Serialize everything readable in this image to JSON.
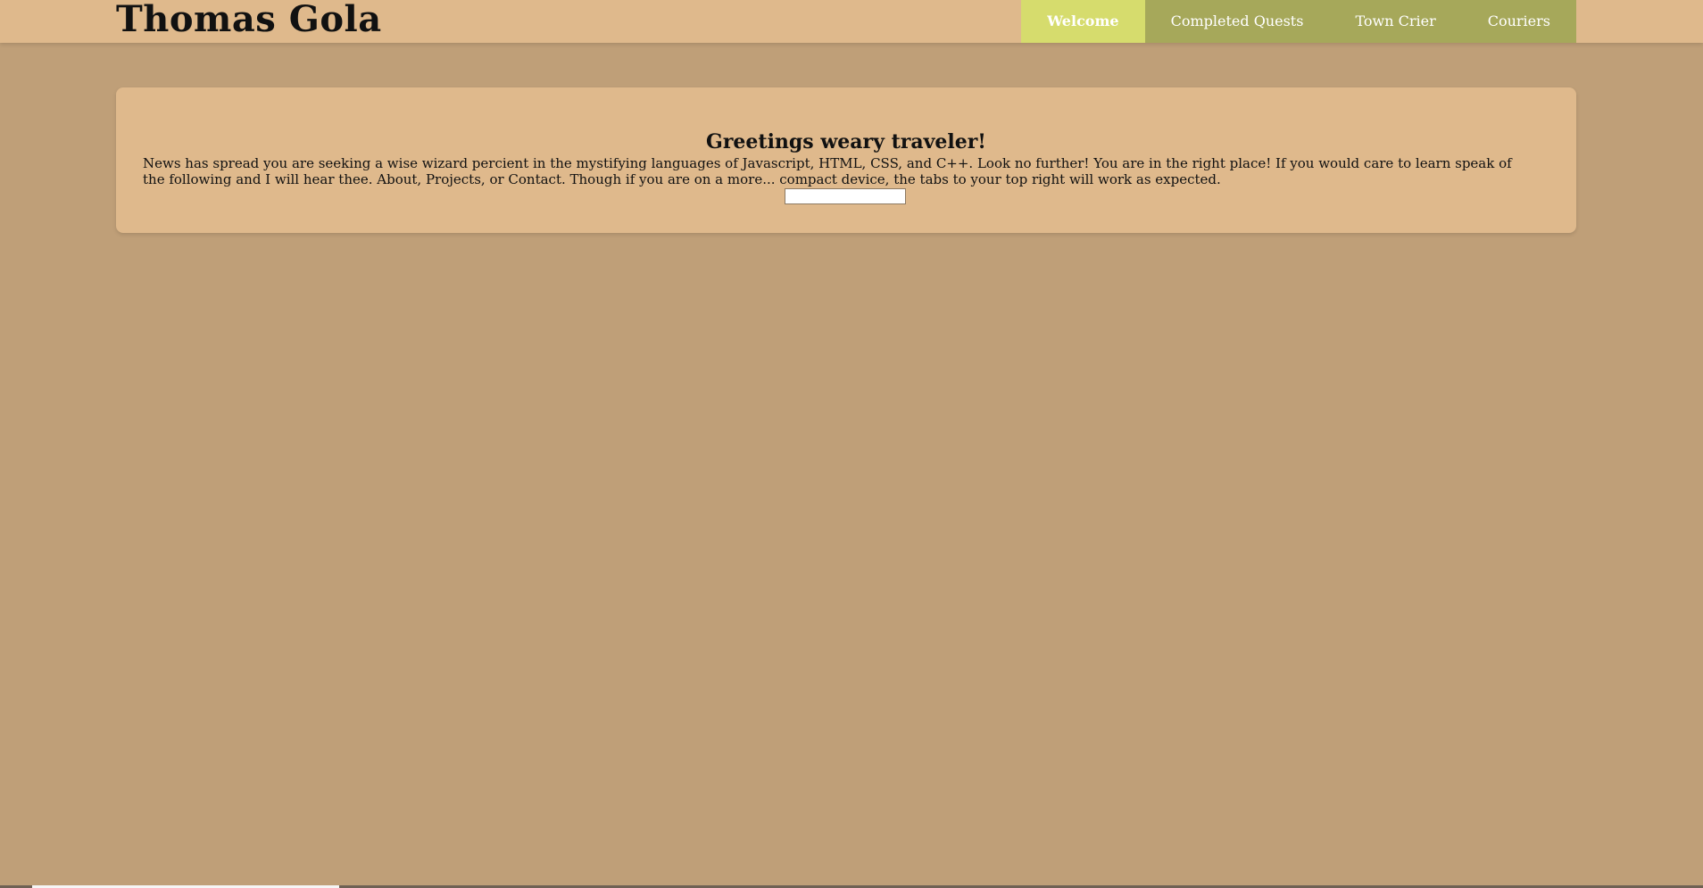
{
  "header": {
    "brand": "Thomas Gola"
  },
  "nav": {
    "items": [
      {
        "label": "Welcome"
      },
      {
        "label": "Completed Quests"
      },
      {
        "label": "Town Crier"
      },
      {
        "label": "Couriers"
      }
    ]
  },
  "welcome": {
    "title": "Greetings weary traveler!",
    "message": "News has spread you are seeking a wise wizard percient in the mystifying languages of Javascript, HTML, CSS, and C++. Look no further! You are in the right place! If you would care to learn speak of the following and I will hear thee. About, Projects, or Contact. Though if you are on a more... compact device, the tabs to your top right will work as expected.",
    "input_value": "",
    "input_placeholder": ""
  },
  "colors": {
    "background": "#bf9f78",
    "header": "#dfb98c",
    "nav_default": "#a6a85a",
    "nav_active": "#d6dc6d"
  }
}
